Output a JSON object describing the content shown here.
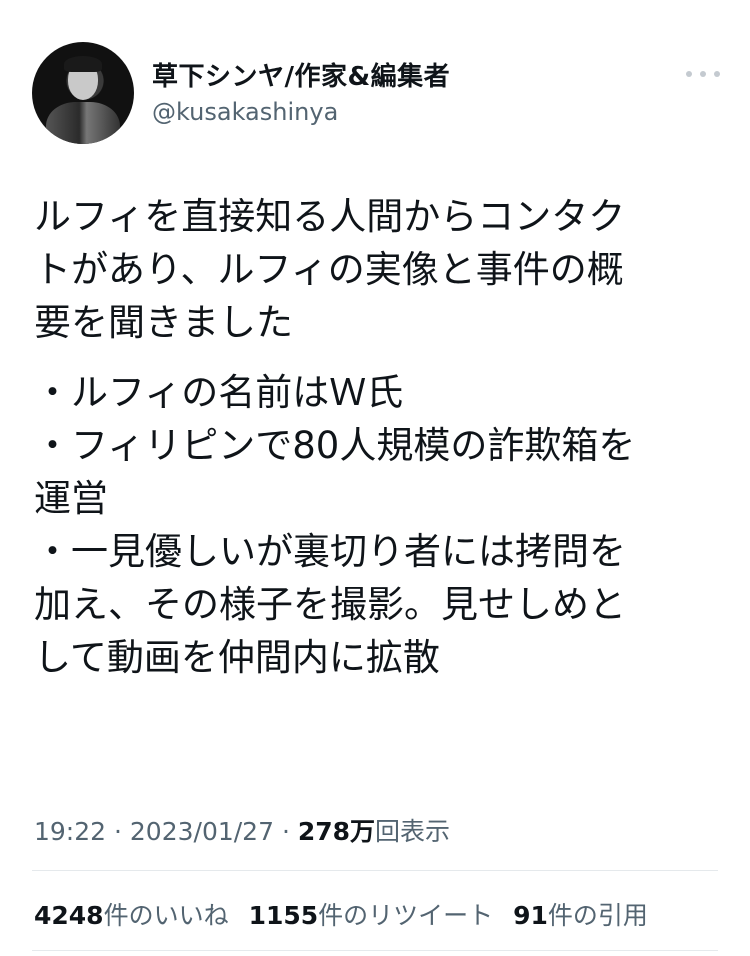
{
  "user": {
    "display_name": "草下シンヤ/作家&編集者",
    "handle": "@kusakashinya"
  },
  "tweet": {
    "paragraphs": [
      "ルフィを直接知る人間からコンタク\nトがあり、ルフィの実像と事件の概\n要を聞きました",
      "・ルフィの名前はＷ氏\n・フィリピンで80人規模の詐欺箱を\n運営\n・一見優しいが裏切り者には拷問を\n加え、その様子を撮影。見せしめと\nして動画を仲間内に拡散"
    ]
  },
  "meta": {
    "time": "19:22",
    "separator": "·",
    "date": "2023/01/27",
    "views_count": "278万",
    "views_label": "回表示"
  },
  "stats": {
    "likes_count": "4248",
    "likes_label": "件のいいね",
    "retweets_count": "1155",
    "retweets_label": "件のリツイート",
    "quotes_count": "91",
    "quotes_label": "件の引用"
  },
  "icons": {
    "avatar": "profile-photo",
    "more": "more-horizontal-icon"
  },
  "colors": {
    "text": "#0f1419",
    "secondary": "#536471",
    "divider": "#e5e9ec"
  }
}
